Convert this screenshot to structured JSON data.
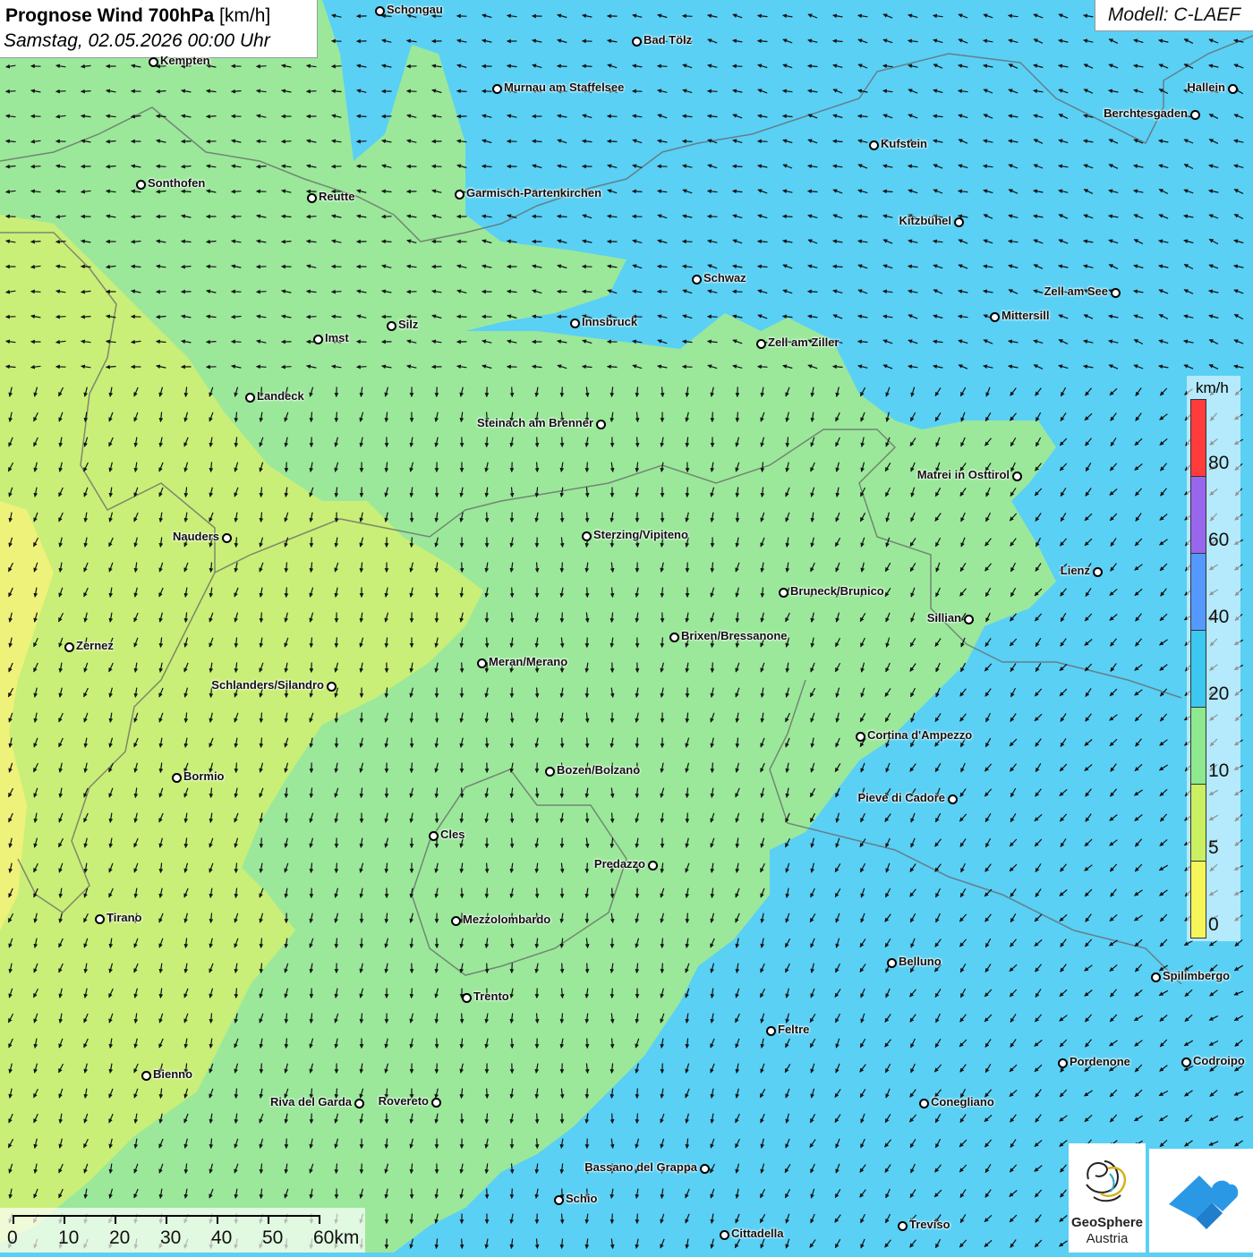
{
  "title": {
    "main": "Prognose Wind 700hPa",
    "unit": "[km/h]",
    "date": "Samstag, 02.05.2026 00:00 Uhr"
  },
  "model": "Modell: C-LAEF",
  "legend": {
    "unit": "km/h",
    "segments": [
      {
        "color": "#ff3b3b"
      },
      {
        "color": "#9966ee"
      },
      {
        "color": "#5599ff"
      },
      {
        "color": "#3cc8f0"
      },
      {
        "color": "#8ee88e"
      },
      {
        "color": "#c8f060"
      },
      {
        "color": "#f5f55a"
      }
    ],
    "labels": [
      "80",
      "60",
      "40",
      "20",
      "10",
      "5",
      "0"
    ]
  },
  "scalebar": {
    "labels": [
      "0",
      "10",
      "20",
      "30",
      "40",
      "50",
      "60km"
    ]
  },
  "logos": {
    "geosphere_line1": "GeoSphere",
    "geosphere_line2": "Austria"
  },
  "cities": [
    "Schongau",
    "Bad Tölz",
    "Kempten",
    "Murnau am Staffelsee",
    "Hallein",
    "Berchtesgaden",
    "Kufstein",
    "Sonthofen",
    "Reutte",
    "Garmisch-Partenkirchen",
    "Kitzbühel",
    "Schwaz",
    "Zell am See",
    "Mittersill",
    "Innsbruck",
    "Silz",
    "Imst",
    "Zell am Ziller",
    "Landeck",
    "Steinach am Brenner",
    "Matrei in Osttirol",
    "Nauders",
    "Sterzing/Vipiteno",
    "Lienz",
    "Bruneck/Brunico",
    "Sillian",
    "Brixen/Bressanone",
    "Zernez",
    "Meran/Merano",
    "Schlanders/Silandro",
    "Cortina d'Ampezzo",
    "Bormio",
    "Bozen/Bolzano",
    "Pieve di Cadore",
    "Cles",
    "Predazzo",
    "Tirano",
    "Mezzolombardo",
    "Belluno",
    "Spilimbergo",
    "Trento",
    "Feltre",
    "Pordenone",
    "Codroipo",
    "Bienno",
    "Riva del Garda",
    "Rovereto",
    "Conegliano",
    "Bassano del Grappa",
    "Schio",
    "Treviso",
    "Cittadella"
  ],
  "colors": {
    "zone_blue": "#5ad0f5",
    "zone_green": "#9be89b",
    "zone_yellowgreen": "#c9ef78",
    "zone_yellow": "#eef27a"
  }
}
